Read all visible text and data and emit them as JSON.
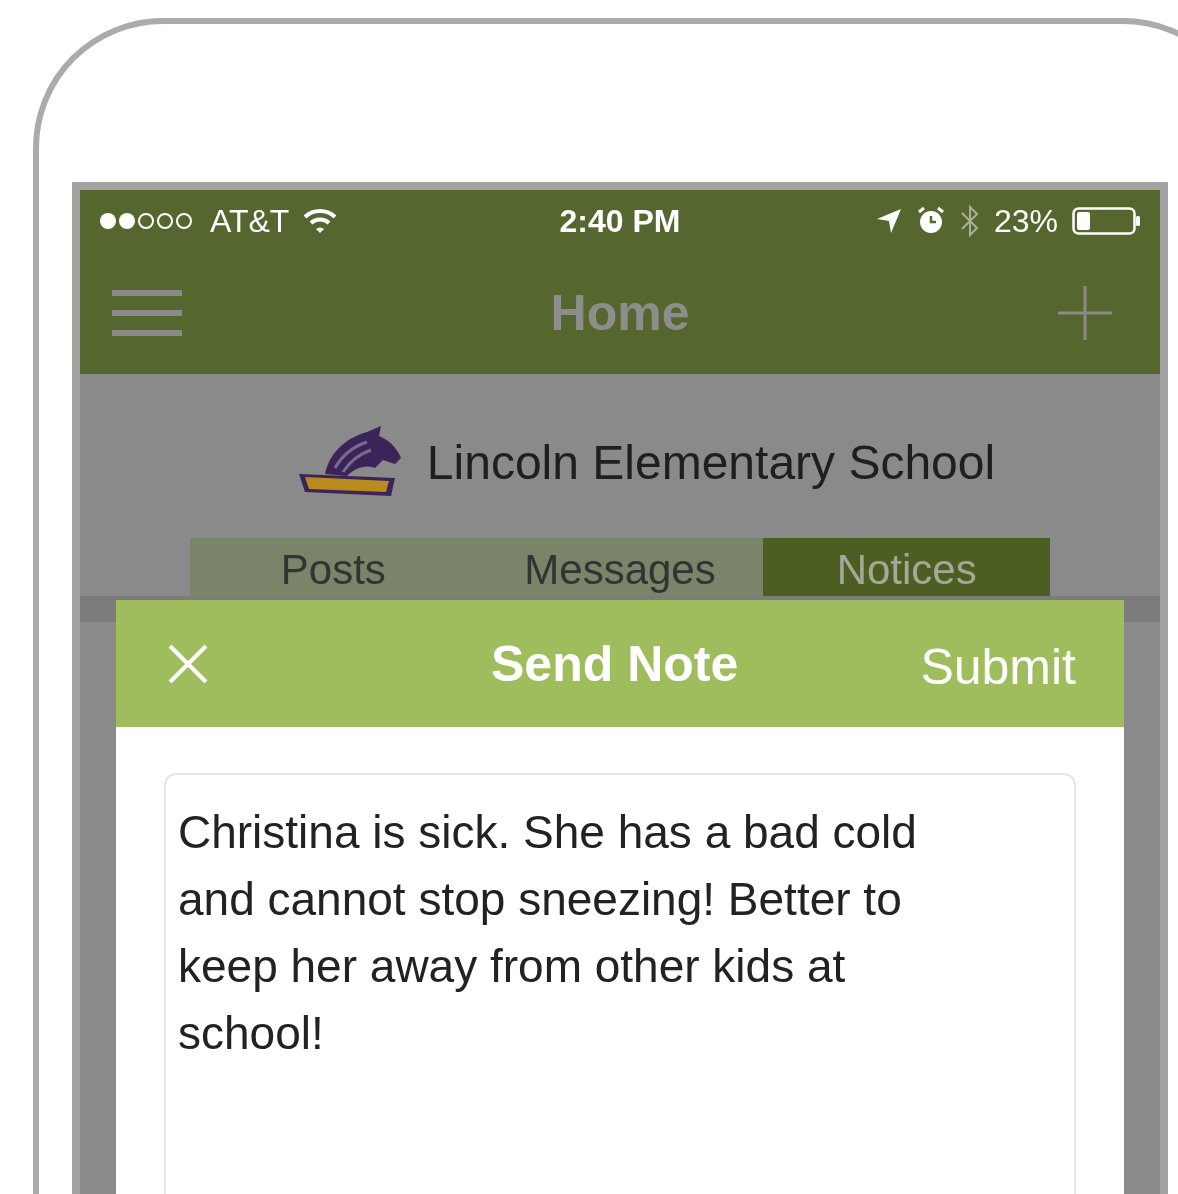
{
  "status_bar": {
    "carrier": "AT&T",
    "time": "2:40 PM",
    "battery": "23%"
  },
  "nav_bar": {
    "title": "Home"
  },
  "school": {
    "name": "Lincoln Elementary School"
  },
  "tabs": [
    {
      "label": "Posts",
      "selected": false
    },
    {
      "label": "Messages",
      "selected": false
    },
    {
      "label": "Notices",
      "selected": true
    }
  ],
  "dialog": {
    "title": "Send Note",
    "submit": "Submit",
    "note": {
      "value": "Christina is sick. She has a bad cold and cannot stop sneezing! Better to keep her away from other kids at school!"
    }
  }
}
